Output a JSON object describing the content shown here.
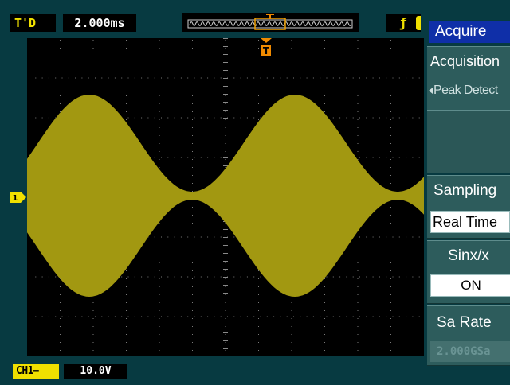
{
  "status_bar": {
    "trigger_status": "T'D",
    "timebase": "2.000ms",
    "trigger_type_symbol": "ƒ"
  },
  "channel": {
    "marker": "1",
    "badge": "CH1",
    "scale": "10.0V"
  },
  "trigger_marker_label": "T",
  "colors": {
    "trace": "#a29811",
    "channel_yellow": "#f0e000",
    "trigger_orange": "#f08a00",
    "menu_title_bg": "#0f2fa8",
    "menu_bg": "#2d5c5c",
    "background": "#073a41"
  },
  "menu": {
    "title": "Acquire",
    "acquisition": {
      "label": "Acquisition",
      "value": "Peak Detect"
    },
    "sampling": {
      "label": "Sampling",
      "value": "Real Time"
    },
    "sinx": {
      "label": "Sinx/x",
      "value": "ON"
    },
    "sa_rate": {
      "label": "Sa Rate",
      "value": "2.000GSa"
    }
  },
  "icons": {
    "channel_marker": "channel-1-arrow-icon",
    "trigger_marker": "trigger-t-icon",
    "memory_window": "waveform-window-icon"
  }
}
